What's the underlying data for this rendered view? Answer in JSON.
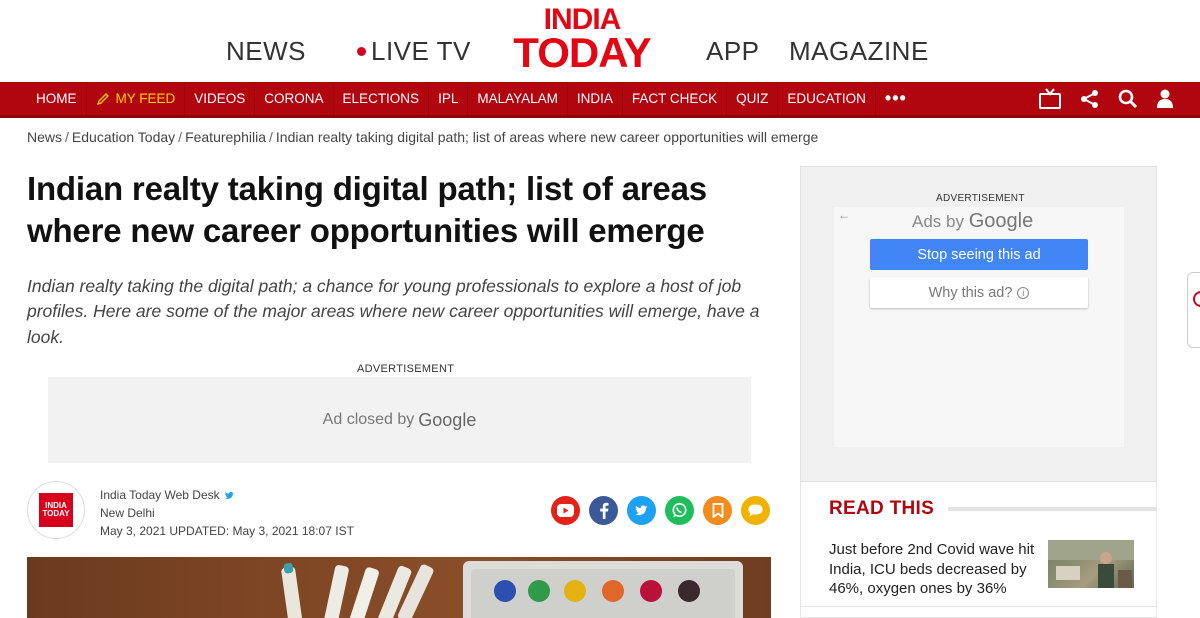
{
  "top_nav": {
    "news": "NEWS",
    "live_tv": "LIVE TV",
    "logo_line1": "INDIA",
    "logo_line2": "TODAY",
    "app": "APP",
    "magazine": "MAGAZINE"
  },
  "nav": {
    "items": [
      "HOME",
      "MY FEED",
      "VIDEOS",
      "CORONA",
      "ELECTIONS",
      "IPL",
      "MALAYALAM",
      "INDIA",
      "FACT CHECK",
      "QUIZ",
      "EDUCATION"
    ],
    "more": "•••",
    "icons": [
      "tv-icon",
      "share-icon",
      "search-icon",
      "user-icon"
    ]
  },
  "breadcrumb": {
    "items": [
      "News",
      "Education Today",
      "Featurephilia",
      "Indian realty taking digital path; list of areas where new career opportunities will emerge"
    ],
    "separator": "/"
  },
  "article": {
    "headline": "Indian realty taking digital path; list of areas where new career opportunities will emerge",
    "standfirst": "Indian realty taking the digital path; a chance for young professionals to explore a host of job profiles. Here are some of the major areas where new career opportunities will emerge, have a look.",
    "ad_label": "ADVERTISEMENT",
    "ad_closed_text": "Ad closed by",
    "ad_closed_brand": "Google",
    "author": "India Today Web Desk",
    "location": "New Delhi",
    "date_line": "May 3, 2021  UPDATED: May 3, 2021 18:07 IST",
    "avatar_line1": "INDIA",
    "avatar_line2": "TODAY",
    "social_icons": [
      "youtube-icon",
      "facebook-icon",
      "twitter-icon",
      "whatsapp-icon",
      "bookmark-icon",
      "comment-icon"
    ]
  },
  "sidebar": {
    "ad_label": "ADVERTISEMENT",
    "ads_by": "Ads by",
    "ads_brand": "Google",
    "stop_button": "Stop seeing this ad",
    "why_button": "Why this ad?",
    "read_this_title": "READ THIS",
    "read_this_item": "Just before 2nd Covid wave hit India, ICU beds decreased by 46%, oxygen ones by 36%"
  },
  "colors": {
    "brand_red": "#b1060f",
    "logo_red": "#e30613",
    "feed_yellow": "#ffd200",
    "google_blue": "#4285f4"
  }
}
